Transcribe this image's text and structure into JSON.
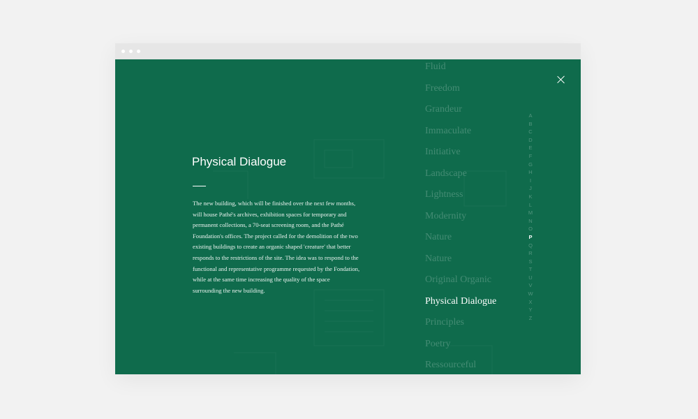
{
  "window": {
    "dots": 3
  },
  "detail": {
    "title": "Physical Dialogue",
    "body": "The new building, which will be finished over the next few months, will house Pathé's archives, exhibition spaces for temporary and permanent collections, a 70-seat screening room, and the Pathé Foundation's offices. The project called for the demolition of the two existing buildings to create an organic shaped 'creature' that better responds to the restrictions of the site. The idea was to respond to the functional and representative programme requested by the Fondation, while at the same time increasing the quality of the space surrounding the new building."
  },
  "close_icon": "close-icon",
  "terms": [
    "Fluid",
    "Freedom",
    "Grandeur",
    "Immaculate",
    "Initiative",
    "Landscape",
    "Lightness",
    "Modernity",
    "Nature",
    "Nature",
    "Original Organic",
    "Physical Dialogue",
    "Principles",
    "Poetry",
    "Ressourceful"
  ],
  "active_term": "Physical Dialogue",
  "alphabet": [
    "A",
    "B",
    "C",
    "D",
    "E",
    "F",
    "G",
    "H",
    "I",
    "J",
    "K",
    "L",
    "M",
    "N",
    "O",
    "P",
    "Q",
    "R",
    "S",
    "T",
    "U",
    "V",
    "W",
    "X",
    "Y",
    "Z"
  ],
  "active_letter": "P",
  "colors": {
    "panel": "#0f6b4c",
    "page_background": "#f2f2f2",
    "chrome": "#e6e6e6",
    "text_active": "#ffffff",
    "text_muted": "rgba(255,255,255,0.22)"
  }
}
